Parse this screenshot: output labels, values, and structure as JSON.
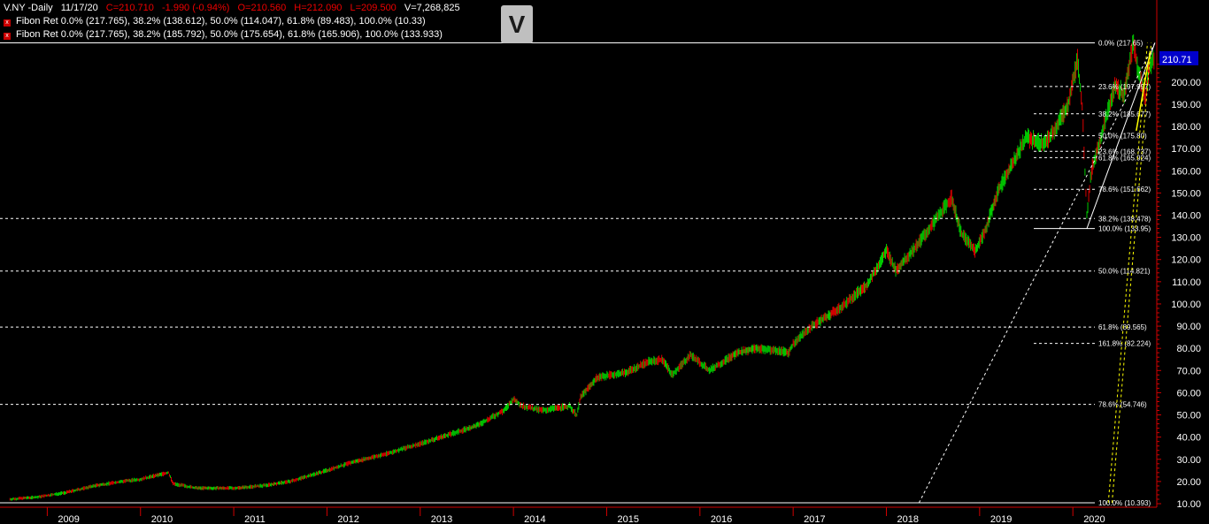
{
  "header": {
    "symbol": "V.NY -Daily",
    "date": "11/17/20",
    "close": "C=210.710",
    "change": "-1.990 (-0.94%)",
    "open": "O=210.560",
    "high": "H=212.090",
    "low": "L=209.500",
    "volume": "V=7,268,825"
  },
  "fib_rows": [
    "Fibon Ret  0.0% (217.765), 38.2% (138.612), 50.0% (114.047), 61.8% (89.483), 100.0% (10.33)",
    "Fibon Ret  0.0% (217.765), 38.2% (185.792), 50.0% (175.654), 61.8% (165.906), 100.0% (133.933)"
  ],
  "badge": "V",
  "colors": {
    "up": "#00cc00",
    "down": "#dd0000",
    "axis": "#d00000",
    "grid": "#ffffff",
    "price_label": "#0000cc",
    "badge": "#bfbfbf"
  },
  "chart_data": {
    "type": "line",
    "title": "V.NY -Daily",
    "y_range": [
      10,
      225
    ],
    "x_range": [
      2008.55,
      2020.9
    ],
    "y_ticks": [
      10,
      20,
      30,
      40,
      50,
      60,
      70,
      80,
      90,
      100,
      110,
      120,
      130,
      140,
      150,
      160,
      170,
      180,
      190,
      200
    ],
    "y_tick_labels": [
      "10.00",
      "20.00",
      "30.00",
      "40.00",
      "50.00",
      "60.00",
      "70.00",
      "80.00",
      "90.00",
      "100.00",
      "110.00",
      "120.00",
      "130.00",
      "140.00",
      "150.00",
      "160.00",
      "170.00",
      "180.00",
      "190.00",
      "200.00"
    ],
    "x_ticks": [
      2009,
      2010,
      2011,
      2012,
      2013,
      2014,
      2015,
      2016,
      2017,
      2018,
      2019,
      2020
    ],
    "x_tick_labels": [
      "2009",
      "2010",
      "2011",
      "2012",
      "2013",
      "2014",
      "2015",
      "2016",
      "2017",
      "2018",
      "2019",
      "2020"
    ],
    "last_price": 210.71,
    "last_price_label": "210.71",
    "price_series": {
      "name": "V.NY",
      "points": [
        [
          2008.6,
          12
        ],
        [
          2008.9,
          13
        ],
        [
          2009.2,
          15
        ],
        [
          2009.5,
          18
        ],
        [
          2009.8,
          20
        ],
        [
          2010.0,
          21
        ],
        [
          2010.3,
          24
        ],
        [
          2010.35,
          19
        ],
        [
          2010.6,
          17
        ],
        [
          2011.0,
          17
        ],
        [
          2011.3,
          18
        ],
        [
          2011.6,
          20
        ],
        [
          2012.0,
          25
        ],
        [
          2012.3,
          29
        ],
        [
          2012.6,
          32
        ],
        [
          2013.0,
          37
        ],
        [
          2013.3,
          41
        ],
        [
          2013.6,
          45
        ],
        [
          2013.9,
          52
        ],
        [
          2014.0,
          57
        ],
        [
          2014.1,
          54
        ],
        [
          2014.3,
          52
        ],
        [
          2014.6,
          54
        ],
        [
          2014.68,
          50
        ],
        [
          2014.72,
          58
        ],
        [
          2014.9,
          67
        ],
        [
          2015.2,
          69
        ],
        [
          2015.45,
          74
        ],
        [
          2015.6,
          75
        ],
        [
          2015.7,
          68
        ],
        [
          2015.9,
          77
        ],
        [
          2016.1,
          70
        ],
        [
          2016.4,
          78
        ],
        [
          2016.6,
          80
        ],
        [
          2016.85,
          79
        ],
        [
          2016.95,
          78
        ],
        [
          2017.0,
          82
        ],
        [
          2017.2,
          90
        ],
        [
          2017.5,
          98
        ],
        [
          2017.8,
          109
        ],
        [
          2018.0,
          124
        ],
        [
          2018.1,
          115
        ],
        [
          2018.3,
          125
        ],
        [
          2018.5,
          136
        ],
        [
          2018.7,
          148
        ],
        [
          2018.8,
          132
        ],
        [
          2018.95,
          124
        ],
        [
          2019.05,
          132
        ],
        [
          2019.2,
          151
        ],
        [
          2019.4,
          167
        ],
        [
          2019.5,
          175
        ],
        [
          2019.7,
          172
        ],
        [
          2019.8,
          178
        ],
        [
          2019.95,
          190
        ],
        [
          2020.05,
          210
        ],
        [
          2020.1,
          189
        ],
        [
          2020.15,
          140
        ],
        [
          2020.2,
          160
        ],
        [
          2020.3,
          175
        ],
        [
          2020.45,
          198
        ],
        [
          2020.55,
          195
        ],
        [
          2020.65,
          218
        ],
        [
          2020.7,
          205
        ],
        [
          2020.78,
          193
        ],
        [
          2020.82,
          208
        ],
        [
          2020.88,
          210.71
        ]
      ]
    },
    "fib_set_1": {
      "levels": [
        {
          "label": "0.0% (217.65)",
          "value": 217.65
        },
        {
          "label": "38.2% (138.478)",
          "value": 138.478
        },
        {
          "label": "50.0% (114.821)",
          "value": 114.821
        },
        {
          "label": "61.8% (89.565)",
          "value": 89.565
        },
        {
          "label": "78.6% (54.746)",
          "value": 54.746
        },
        {
          "label": "100.0% (10.393)",
          "value": 10.393
        }
      ]
    },
    "fib_set_2": {
      "levels": [
        {
          "label": "23.6% (197.997)",
          "value": 197.997
        },
        {
          "label": "38.2% (185.677)",
          "value": 185.677
        },
        {
          "label": "50.0% (175.80)",
          "value": 175.8
        },
        {
          "label": "23.6% (168.737)",
          "value": 168.737
        },
        {
          "label": "61.8% (165.924)",
          "value": 165.924
        },
        {
          "label": "78.6% (151.662)",
          "value": 151.662
        },
        {
          "label": "100.0% (133.95)",
          "value": 133.95
        },
        {
          "label": "161.8% (82.224)",
          "value": 82.224
        }
      ]
    }
  }
}
